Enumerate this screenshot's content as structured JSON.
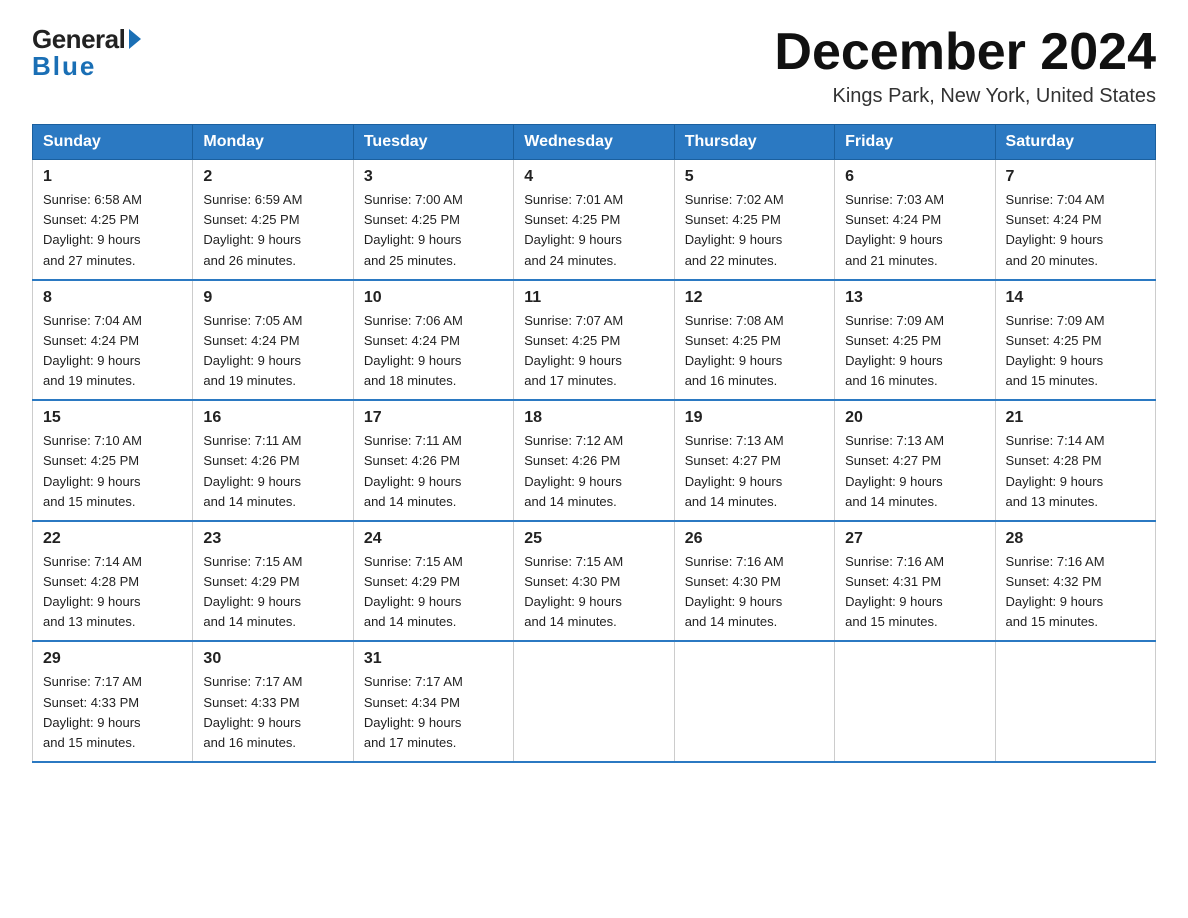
{
  "logo": {
    "general": "General",
    "blue": "Blue"
  },
  "title": "December 2024",
  "location": "Kings Park, New York, United States",
  "days_of_week": [
    "Sunday",
    "Monday",
    "Tuesday",
    "Wednesday",
    "Thursday",
    "Friday",
    "Saturday"
  ],
  "weeks": [
    [
      {
        "day": "1",
        "sunrise": "6:58 AM",
        "sunset": "4:25 PM",
        "daylight": "9 hours and 27 minutes."
      },
      {
        "day": "2",
        "sunrise": "6:59 AM",
        "sunset": "4:25 PM",
        "daylight": "9 hours and 26 minutes."
      },
      {
        "day": "3",
        "sunrise": "7:00 AM",
        "sunset": "4:25 PM",
        "daylight": "9 hours and 25 minutes."
      },
      {
        "day": "4",
        "sunrise": "7:01 AM",
        "sunset": "4:25 PM",
        "daylight": "9 hours and 24 minutes."
      },
      {
        "day": "5",
        "sunrise": "7:02 AM",
        "sunset": "4:25 PM",
        "daylight": "9 hours and 22 minutes."
      },
      {
        "day": "6",
        "sunrise": "7:03 AM",
        "sunset": "4:24 PM",
        "daylight": "9 hours and 21 minutes."
      },
      {
        "day": "7",
        "sunrise": "7:04 AM",
        "sunset": "4:24 PM",
        "daylight": "9 hours and 20 minutes."
      }
    ],
    [
      {
        "day": "8",
        "sunrise": "7:04 AM",
        "sunset": "4:24 PM",
        "daylight": "9 hours and 19 minutes."
      },
      {
        "day": "9",
        "sunrise": "7:05 AM",
        "sunset": "4:24 PM",
        "daylight": "9 hours and 19 minutes."
      },
      {
        "day": "10",
        "sunrise": "7:06 AM",
        "sunset": "4:24 PM",
        "daylight": "9 hours and 18 minutes."
      },
      {
        "day": "11",
        "sunrise": "7:07 AM",
        "sunset": "4:25 PM",
        "daylight": "9 hours and 17 minutes."
      },
      {
        "day": "12",
        "sunrise": "7:08 AM",
        "sunset": "4:25 PM",
        "daylight": "9 hours and 16 minutes."
      },
      {
        "day": "13",
        "sunrise": "7:09 AM",
        "sunset": "4:25 PM",
        "daylight": "9 hours and 16 minutes."
      },
      {
        "day": "14",
        "sunrise": "7:09 AM",
        "sunset": "4:25 PM",
        "daylight": "9 hours and 15 minutes."
      }
    ],
    [
      {
        "day": "15",
        "sunrise": "7:10 AM",
        "sunset": "4:25 PM",
        "daylight": "9 hours and 15 minutes."
      },
      {
        "day": "16",
        "sunrise": "7:11 AM",
        "sunset": "4:26 PM",
        "daylight": "9 hours and 14 minutes."
      },
      {
        "day": "17",
        "sunrise": "7:11 AM",
        "sunset": "4:26 PM",
        "daylight": "9 hours and 14 minutes."
      },
      {
        "day": "18",
        "sunrise": "7:12 AM",
        "sunset": "4:26 PM",
        "daylight": "9 hours and 14 minutes."
      },
      {
        "day": "19",
        "sunrise": "7:13 AM",
        "sunset": "4:27 PM",
        "daylight": "9 hours and 14 minutes."
      },
      {
        "day": "20",
        "sunrise": "7:13 AM",
        "sunset": "4:27 PM",
        "daylight": "9 hours and 14 minutes."
      },
      {
        "day": "21",
        "sunrise": "7:14 AM",
        "sunset": "4:28 PM",
        "daylight": "9 hours and 13 minutes."
      }
    ],
    [
      {
        "day": "22",
        "sunrise": "7:14 AM",
        "sunset": "4:28 PM",
        "daylight": "9 hours and 13 minutes."
      },
      {
        "day": "23",
        "sunrise": "7:15 AM",
        "sunset": "4:29 PM",
        "daylight": "9 hours and 14 minutes."
      },
      {
        "day": "24",
        "sunrise": "7:15 AM",
        "sunset": "4:29 PM",
        "daylight": "9 hours and 14 minutes."
      },
      {
        "day": "25",
        "sunrise": "7:15 AM",
        "sunset": "4:30 PM",
        "daylight": "9 hours and 14 minutes."
      },
      {
        "day": "26",
        "sunrise": "7:16 AM",
        "sunset": "4:30 PM",
        "daylight": "9 hours and 14 minutes."
      },
      {
        "day": "27",
        "sunrise": "7:16 AM",
        "sunset": "4:31 PM",
        "daylight": "9 hours and 15 minutes."
      },
      {
        "day": "28",
        "sunrise": "7:16 AM",
        "sunset": "4:32 PM",
        "daylight": "9 hours and 15 minutes."
      }
    ],
    [
      {
        "day": "29",
        "sunrise": "7:17 AM",
        "sunset": "4:33 PM",
        "daylight": "9 hours and 15 minutes."
      },
      {
        "day": "30",
        "sunrise": "7:17 AM",
        "sunset": "4:33 PM",
        "daylight": "9 hours and 16 minutes."
      },
      {
        "day": "31",
        "sunrise": "7:17 AM",
        "sunset": "4:34 PM",
        "daylight": "9 hours and 17 minutes."
      },
      null,
      null,
      null,
      null
    ]
  ],
  "labels": {
    "sunrise": "Sunrise:",
    "sunset": "Sunset:",
    "daylight": "Daylight:"
  }
}
